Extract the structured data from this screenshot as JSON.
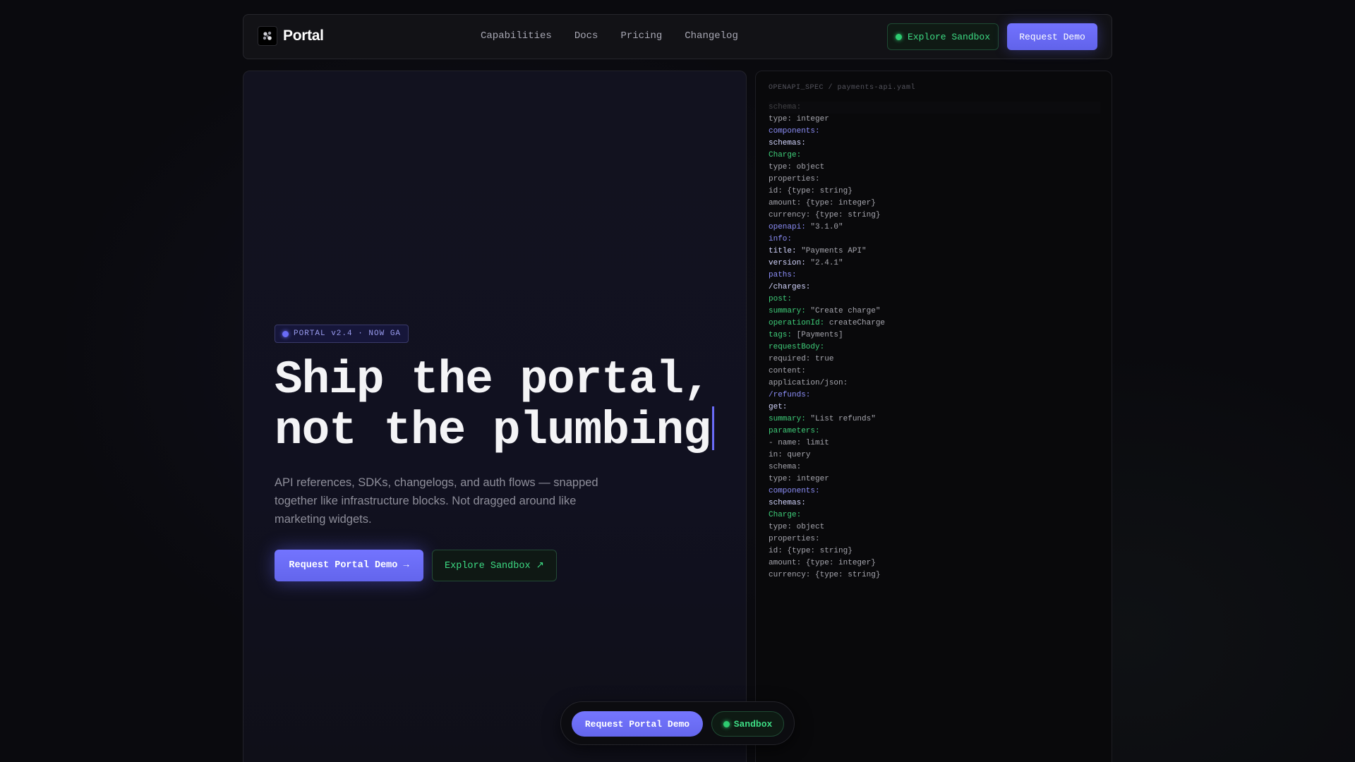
{
  "nav": {
    "brand": "Portal",
    "links": [
      "Capabilities",
      "Docs",
      "Pricing",
      "Changelog"
    ],
    "sandbox_label": "Explore Sandbox",
    "demo_label": "Request Demo"
  },
  "hero": {
    "badge": "PORTAL v2.4 · NOW GA",
    "headline_line1": "Ship the portal,",
    "headline_line2": "not the plumbing",
    "subtext": "API references, SDKs, changelogs, and auth flows — snapped together like infrastructure blocks. Not dragged around like marketing widgets.",
    "primary_label": "Request Portal Demo →",
    "secondary_label": "Explore Sandbox ↗"
  },
  "code": {
    "title": "OPENAPI_SPEC / payments-api.yaml",
    "lines": [
      {
        "k": "schema:",
        "v": "",
        "c": "gray",
        "faded": true
      },
      {
        "k": "type:",
        "v": " integer",
        "c": "gray"
      },
      {
        "k": "components:",
        "v": "",
        "c": "blue"
      },
      {
        "k": "schemas:",
        "v": "",
        "c": "white"
      },
      {
        "k": "Charge:",
        "v": "",
        "c": "green"
      },
      {
        "k": "type:",
        "v": " object",
        "c": "gray"
      },
      {
        "k": "properties:",
        "v": "",
        "c": "gray"
      },
      {
        "k": "id:",
        "v": " {type: string}",
        "c": "gray"
      },
      {
        "k": "amount:",
        "v": " {type: integer}",
        "c": "gray"
      },
      {
        "k": "currency:",
        "v": " {type: string}",
        "c": "gray"
      },
      {
        "k": "openapi:",
        "v": " \"3.1.0\"",
        "c": "blue"
      },
      {
        "k": "info:",
        "v": "",
        "c": "blue"
      },
      {
        "k": "title:",
        "v": " \"Payments API\"",
        "c": "white"
      },
      {
        "k": "version:",
        "v": " \"2.4.1\"",
        "c": "white"
      },
      {
        "k": "paths:",
        "v": "",
        "c": "blue"
      },
      {
        "k": "/charges:",
        "v": "",
        "c": "white"
      },
      {
        "k": "post:",
        "v": "",
        "c": "green"
      },
      {
        "k": "summary:",
        "v": " \"Create charge\"",
        "c": "green"
      },
      {
        "k": "operationId:",
        "v": " createCharge",
        "c": "green"
      },
      {
        "k": "tags:",
        "v": " [Payments]",
        "c": "green"
      },
      {
        "k": "requestBody:",
        "v": "",
        "c": "green"
      },
      {
        "k": "required:",
        "v": " true",
        "c": "gray"
      },
      {
        "k": "content:",
        "v": "",
        "c": "gray"
      },
      {
        "k": "application/json:",
        "v": "",
        "c": "gray"
      },
      {
        "k": "/refunds:",
        "v": "",
        "c": "blue"
      },
      {
        "k": "get:",
        "v": "",
        "c": "white"
      },
      {
        "k": "summary:",
        "v": " \"List refunds\"",
        "c": "green"
      },
      {
        "k": "parameters:",
        "v": "",
        "c": "green"
      },
      {
        "k": "- name:",
        "v": " limit",
        "c": "gray"
      },
      {
        "k": "in:",
        "v": " query",
        "c": "gray"
      },
      {
        "k": "schema:",
        "v": "",
        "c": "gray"
      },
      {
        "k": "type:",
        "v": " integer",
        "c": "gray"
      },
      {
        "k": "components:",
        "v": "",
        "c": "blue"
      },
      {
        "k": "schemas:",
        "v": "",
        "c": "white"
      },
      {
        "k": "Charge:",
        "v": "",
        "c": "green"
      },
      {
        "k": "type:",
        "v": " object",
        "c": "gray"
      },
      {
        "k": "properties:",
        "v": "",
        "c": "gray"
      },
      {
        "k": "id:",
        "v": " {type: string}",
        "c": "gray"
      },
      {
        "k": "amount:",
        "v": " {type: integer}",
        "c": "gray"
      },
      {
        "k": "currency:",
        "v": " {type: string}",
        "c": "gray"
      }
    ]
  },
  "float_bar": {
    "demo_label": "Request Portal Demo",
    "sandbox_label": "Sandbox"
  },
  "colors": {
    "accent": "#6a6cf8",
    "success": "#3ddc84",
    "background": "#0a0a0e"
  },
  "icons": {
    "logo": "cluster-logo-icon",
    "status": "status-dot-icon"
  }
}
